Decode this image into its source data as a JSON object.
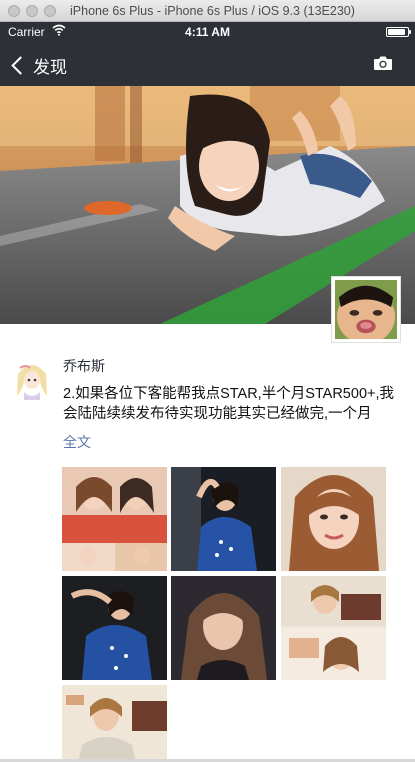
{
  "window": {
    "title": "iPhone 6s Plus - iPhone 6s Plus / iOS 9.3 (13E230)"
  },
  "status_bar": {
    "carrier": "Carrier",
    "time": "4:11 AM",
    "battery_level": 0.9
  },
  "nav": {
    "back_label": "发现",
    "camera_icon": "camera-icon"
  },
  "post": {
    "author": "乔布斯",
    "text": "2.如果各位下客能帮我点STAR,半个月STAR500+,我会陆陆续续发布待实现功能其实已经做完,一个月",
    "more_label": "全文",
    "photo_count": 7
  },
  "colors": {
    "nav_bg": "#2d3036",
    "link": "#5e77a9",
    "name": "#2a2f3a"
  }
}
